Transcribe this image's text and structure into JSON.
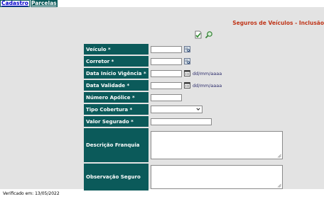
{
  "tabs": [
    {
      "label": "Cadastro",
      "active": true
    },
    {
      "label": "Parcelas",
      "active": false
    }
  ],
  "page_title": "Seguros de Veículos - Inclusão",
  "toolbar": {
    "confirm_icon": "confirm-icon",
    "search_icon": "search-icon"
  },
  "form": {
    "veiculo": {
      "label": "Veículo *",
      "value": ""
    },
    "corretor": {
      "label": "Corretor *",
      "value": ""
    },
    "data_inicio": {
      "label": "Data Início Vigência *",
      "value": "",
      "hint": "dd/mm/aaaa"
    },
    "data_validade": {
      "label": "Data Validade *",
      "value": "",
      "hint": "dd/mm/aaaa"
    },
    "numero_apolice": {
      "label": "Número Apólice *",
      "value": ""
    },
    "tipo_cobertura": {
      "label": "Tipo Cobertura *",
      "selected": ""
    },
    "valor_segurado": {
      "label": "Valor Segurado *",
      "value": ""
    },
    "descricao_franquia": {
      "label": "Descrição Franquia",
      "value": ""
    },
    "observacao_seguro": {
      "label": "Observação Seguro",
      "value": ""
    }
  },
  "footer": {
    "text": "Verificado em: 13/05/2022"
  },
  "colors": {
    "label_bg": "#0b5a5a",
    "title": "#c0361a",
    "panel_bg": "#e3e3e3"
  }
}
